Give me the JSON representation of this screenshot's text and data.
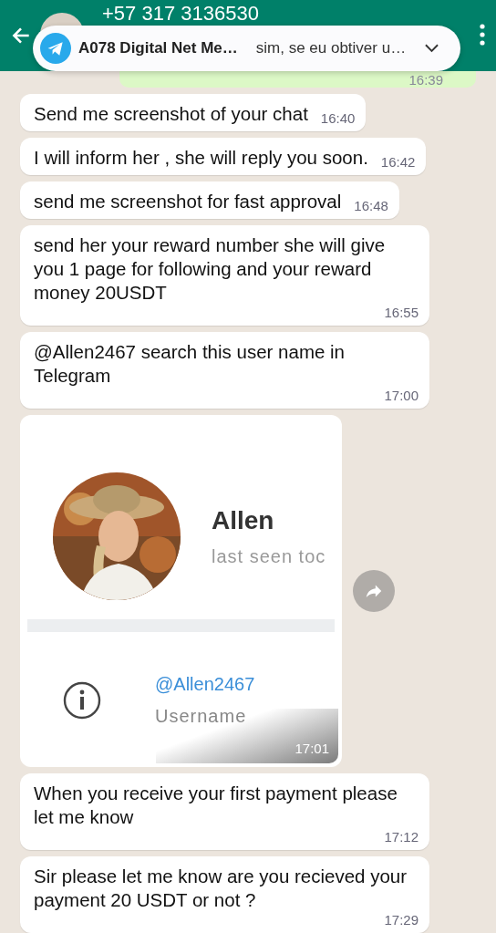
{
  "header": {
    "contact": "+57 317 3136530"
  },
  "notification": {
    "app_name": "A078 Digital Net Me…",
    "preview": "sim, se eu obtiver u…"
  },
  "outgoing_partial": {
    "time": "16:39"
  },
  "messages": [
    {
      "kind": "text",
      "text": "Send me screenshot of your chat",
      "time": "16:40"
    },
    {
      "kind": "text",
      "text": "I will inform her , she will reply you soon.",
      "time": "16:42"
    },
    {
      "kind": "text",
      "text": "send me screenshot for fast approval",
      "time": "16:48"
    },
    {
      "kind": "text",
      "text": "send her your reward number  she will give you 1 page for following and your reward  money 20USDT",
      "time": "16:55"
    },
    {
      "kind": "text",
      "text": "@Allen2467 search this user name in Telegram",
      "time": "17:00"
    },
    {
      "name": "Allen",
      "status": "last seen toc",
      "username": "@Allen2467",
      "username_label": "Username",
      "time": "17:01"
    },
    {
      "kind": "text",
      "text": "When you receive your first payment please let me know",
      "time": "17:12"
    },
    {
      "kind": "text",
      "text": "Sir please let me know are you recieved your payment 20 USDT or not ?",
      "time": "17:29"
    }
  ]
}
